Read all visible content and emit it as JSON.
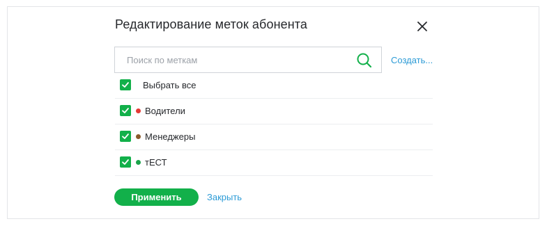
{
  "dialog": {
    "title": "Редактирование меток абонента",
    "close_icon": "close-icon"
  },
  "search": {
    "placeholder": "Поиск по меткам",
    "value": "",
    "icon": "search-icon",
    "create_label": "Создать..."
  },
  "select_all": {
    "label": "Выбрать все",
    "checked": true
  },
  "tags": [
    {
      "label": "Водители",
      "checked": true,
      "color": "#e53935"
    },
    {
      "label": "Менеджеры",
      "checked": true,
      "color": "#8b5a2b"
    },
    {
      "label": "тЕСТ",
      "checked": true,
      "color": "#1aa34a"
    }
  ],
  "footer": {
    "apply_label": "Применить",
    "close_label": "Закрыть"
  },
  "colors": {
    "accent": "#12b04a",
    "link": "#2c9bd6"
  }
}
